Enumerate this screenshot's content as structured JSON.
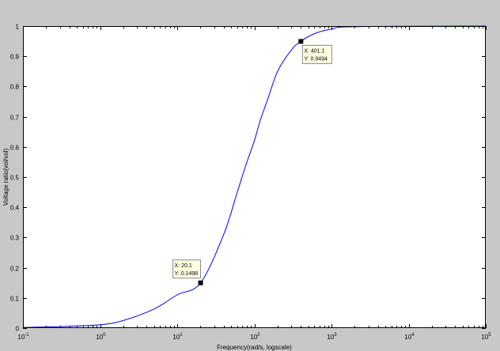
{
  "chart_data": {
    "type": "line",
    "title": "",
    "xlabel": "Frequency(rad/s, logscale)",
    "ylabel": "Voltage ratio(vol/vol)",
    "x_scale": "log",
    "xlim": [
      0.1,
      100000
    ],
    "ylim": [
      0,
      1
    ],
    "grid": false,
    "x_ticks": [
      {
        "value": 0.1,
        "base": "10",
        "exp": "-1"
      },
      {
        "value": 1,
        "base": "10",
        "exp": "0"
      },
      {
        "value": 10,
        "base": "10",
        "exp": "1"
      },
      {
        "value": 100,
        "base": "10",
        "exp": "2"
      },
      {
        "value": 1000,
        "base": "10",
        "exp": "3"
      },
      {
        "value": 10000,
        "base": "10",
        "exp": "4"
      },
      {
        "value": 100000,
        "base": "10",
        "exp": "5"
      }
    ],
    "y_ticks": [
      {
        "value": 0,
        "label": "0"
      },
      {
        "value": 0.1,
        "label": "0.1"
      },
      {
        "value": 0.2,
        "label": "0.2"
      },
      {
        "value": 0.3,
        "label": "0.3"
      },
      {
        "value": 0.4,
        "label": "0.4"
      },
      {
        "value": 0.5,
        "label": "0.5"
      },
      {
        "value": 0.6,
        "label": "0.6"
      },
      {
        "value": 0.7,
        "label": "0.7"
      },
      {
        "value": 0.8,
        "label": "0.8"
      },
      {
        "value": 0.9,
        "label": "0.9"
      },
      {
        "value": 1,
        "label": "1"
      }
    ],
    "series": [
      {
        "color": "#0000ff",
        "x": [
          0.1,
          0.3,
          1,
          2,
          5,
          10,
          20.1,
          40,
          60,
          80,
          100,
          120,
          150,
          200,
          300,
          401.1,
          600,
          1000,
          2000,
          100000
        ],
        "y": [
          0.002,
          0.005,
          0.011,
          0.025,
          0.063,
          0.11,
          0.1498,
          0.31,
          0.45,
          0.55,
          0.62,
          0.69,
          0.76,
          0.85,
          0.92,
          0.9494,
          0.975,
          0.99,
          0.998,
          1.0
        ]
      }
    ],
    "annotations": [
      {
        "x": 20.1,
        "y": 0.1498,
        "line1": "X: 20.1",
        "line2": "Y: 0.1498"
      },
      {
        "x": 401.1,
        "y": 0.9494,
        "line1": "X: 401.1",
        "line2": "Y: 0.9494"
      }
    ]
  },
  "colors": {
    "figure_bg": "#c8c8c8",
    "axes_bg": "#ffffff",
    "line": "#0000ff",
    "datatip_bg": "#ffffe1"
  }
}
